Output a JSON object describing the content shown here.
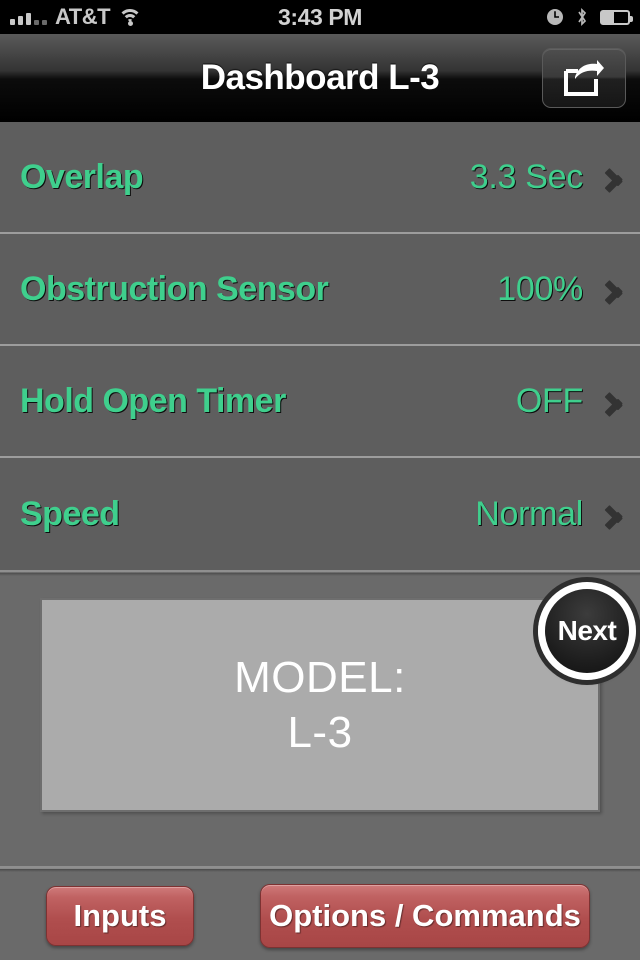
{
  "statusbar": {
    "carrier": "AT&T",
    "time": "3:43 PM",
    "signal_icon": "signal-bars-icon",
    "wifi_icon": "wifi-icon",
    "alarm_icon": "alarm-clock-icon",
    "bluetooth_icon": "bluetooth-icon",
    "battery_icon": "battery-icon"
  },
  "navbar": {
    "title": "Dashboard L-3",
    "share_icon": "share-export-icon"
  },
  "settings": {
    "rows": [
      {
        "label": "Overlap",
        "value": "3.3 Sec",
        "chevron": "chevron-right-icon"
      },
      {
        "label": "Obstruction Sensor",
        "value": "100%",
        "chevron": "chevron-right-icon"
      },
      {
        "label": "Hold Open Timer",
        "value": "OFF",
        "chevron": "chevron-right-icon"
      },
      {
        "label": "Speed",
        "value": "Normal",
        "chevron": "chevron-right-icon"
      }
    ]
  },
  "model_panel": {
    "line1": "MODEL:",
    "line2": "L-3",
    "next_button": "Next"
  },
  "bottombar": {
    "inputs_label": "Inputs",
    "options_label": "Options / Commands"
  },
  "colors": {
    "accent_green": "#3fcf8d",
    "list_background": "#5e5e5e",
    "panel_background": "#ababab",
    "button_red": "#b04e4e",
    "navbar_black": "#000000"
  }
}
